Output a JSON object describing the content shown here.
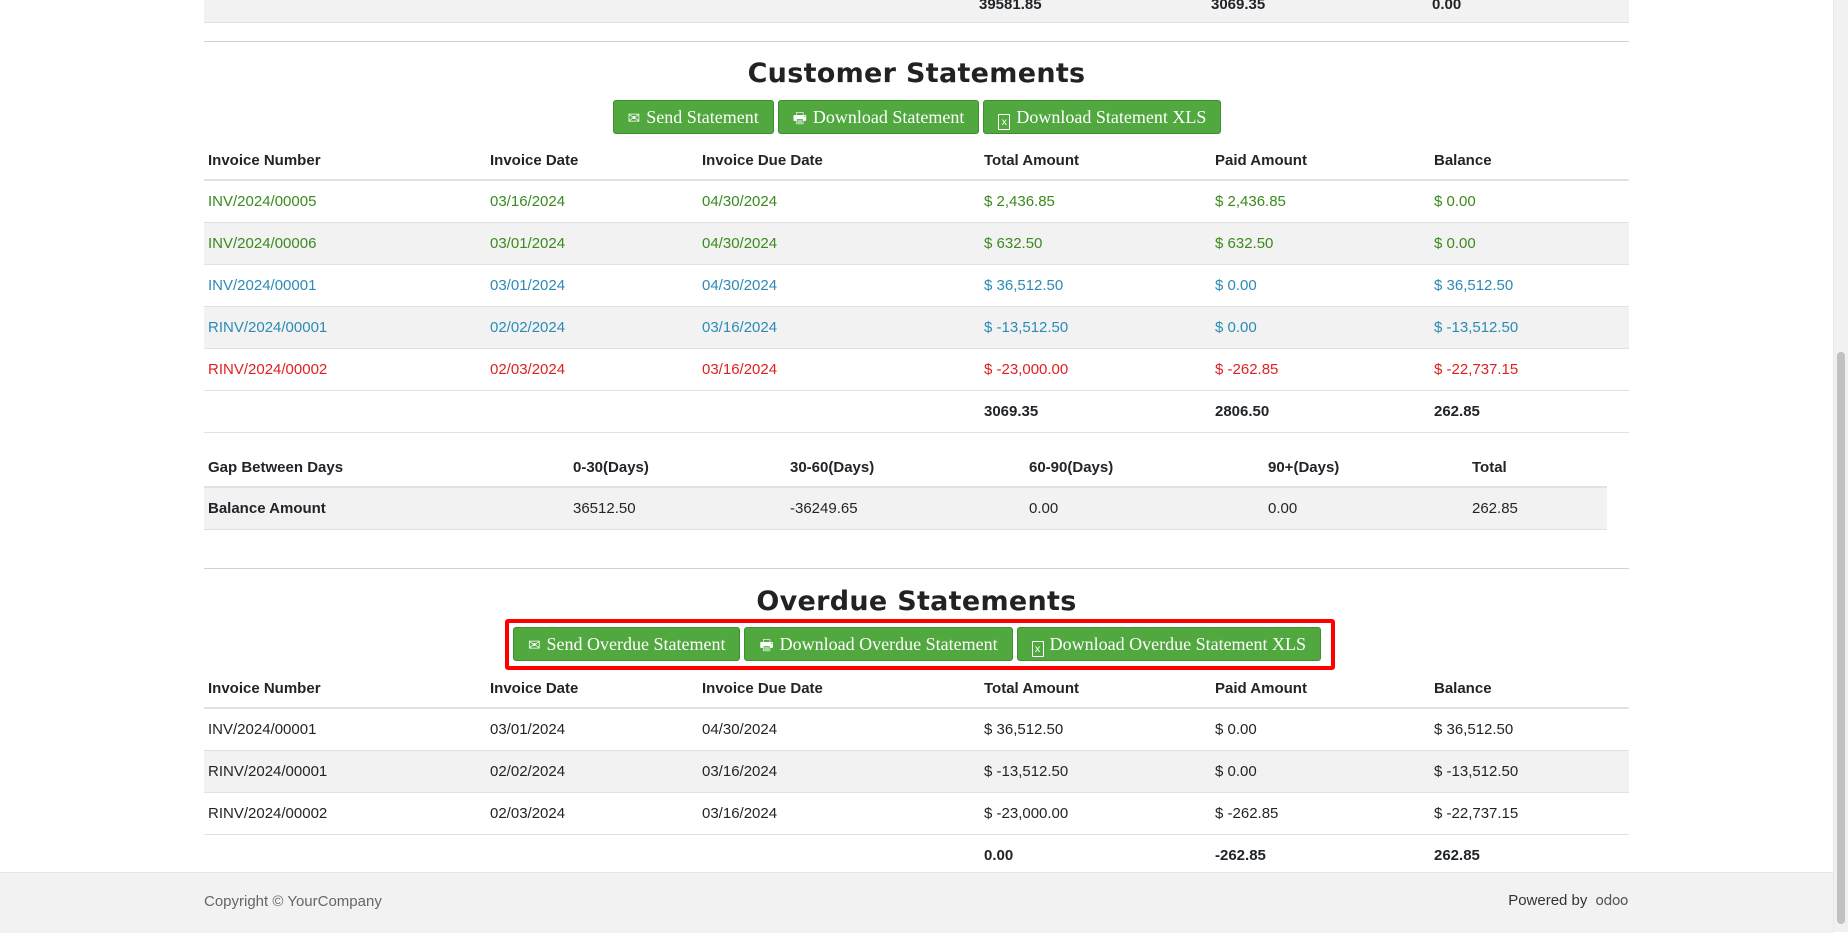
{
  "previous_totals": {
    "total": "39581.85",
    "paid": "3069.35",
    "balance": "0.00"
  },
  "customer": {
    "title": "Customer Statements",
    "buttons": {
      "send": "Send Statement",
      "download": "Download Statement",
      "xls": "Download Statement XLS"
    },
    "headers": [
      "Invoice Number",
      "Invoice Date",
      "Invoice Due Date",
      "Total Amount",
      "Paid Amount",
      "Balance"
    ],
    "rows": [
      {
        "status": "paid",
        "num": "INV/2024/00005",
        "date": "03/16/2024",
        "due": "04/30/2024",
        "total": "$ 2,436.85",
        "paid": "$ 2,436.85",
        "balance": "$ 0.00"
      },
      {
        "status": "paid",
        "num": "INV/2024/00006",
        "date": "03/01/2024",
        "due": "04/30/2024",
        "total": "$ 632.50",
        "paid": "$ 632.50",
        "balance": "$ 0.00"
      },
      {
        "status": "open",
        "num": "INV/2024/00001",
        "date": "03/01/2024",
        "due": "04/30/2024",
        "total": "$ 36,512.50",
        "paid": "$ 0.00",
        "balance": "$ 36,512.50"
      },
      {
        "status": "open",
        "num": "RINV/2024/00001",
        "date": "02/02/2024",
        "due": "03/16/2024",
        "total": "$ -13,512.50",
        "paid": "$ 0.00",
        "balance": "$ -13,512.50"
      },
      {
        "status": "overdue",
        "num": "RINV/2024/00002",
        "date": "02/03/2024",
        "due": "03/16/2024",
        "total": "$ -23,000.00",
        "paid": "$ -262.85",
        "balance": "$ -22,737.15"
      }
    ],
    "totals": {
      "total": "3069.35",
      "paid": "2806.50",
      "balance": "262.85"
    },
    "colors": {
      "paid": "#3a8a1c",
      "open": "#2b8bb5",
      "overdue": "#e02020"
    }
  },
  "aging": {
    "headers": [
      "Gap Between Days",
      "0-30(Days)",
      "30-60(Days)",
      "60-90(Days)",
      "90+(Days)",
      "Total"
    ],
    "row_label": "Balance Amount",
    "values": [
      "36512.50",
      "-36249.65",
      "0.00",
      "0.00",
      "262.85"
    ]
  },
  "overdue": {
    "title": "Overdue Statements",
    "buttons": {
      "send": "Send Overdue Statement",
      "download": "Download Overdue Statement",
      "xls": "Download Overdue Statement XLS"
    },
    "headers": [
      "Invoice Number",
      "Invoice Date",
      "Invoice Due Date",
      "Total Amount",
      "Paid Amount",
      "Balance"
    ],
    "rows": [
      {
        "num": "INV/2024/00001",
        "date": "03/01/2024",
        "due": "04/30/2024",
        "total": "$ 36,512.50",
        "paid": "$ 0.00",
        "balance": "$ 36,512.50"
      },
      {
        "num": "RINV/2024/00001",
        "date": "02/02/2024",
        "due": "03/16/2024",
        "total": "$ -13,512.50",
        "paid": "$ 0.00",
        "balance": "$ -13,512.50"
      },
      {
        "num": "RINV/2024/00002",
        "date": "02/03/2024",
        "due": "03/16/2024",
        "total": "$ -23,000.00",
        "paid": "$ -262.85",
        "balance": "$ -22,737.15"
      }
    ],
    "totals": {
      "total": "0.00",
      "paid": "-262.85",
      "balance": "262.85"
    }
  },
  "footer": {
    "copyright": "Copyright © YourCompany",
    "powered_by": "Powered by",
    "brand": "odoo"
  },
  "icons": {
    "send": "envelope-icon",
    "download": "print-icon",
    "xls": "excel-file-icon"
  }
}
